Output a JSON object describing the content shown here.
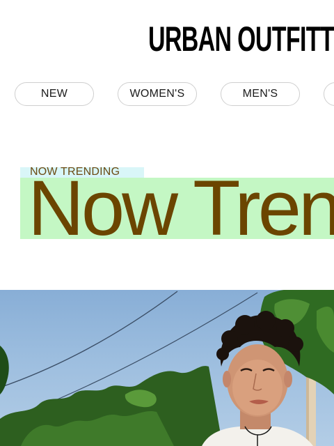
{
  "brand": {
    "logo_text": "URBAN OUTFITTERS"
  },
  "nav": {
    "categories": [
      {
        "label": "NEW"
      },
      {
        "label": "WOMEN'S"
      },
      {
        "label": "MEN'S"
      },
      {
        "label": ""
      }
    ]
  },
  "trending": {
    "eyebrow": "NOW TRENDING",
    "headline": "Now Trending",
    "eyebrow_highlight": "#d9f6f8",
    "headline_highlight": "#c4f7c4",
    "text_color": "#6b4500"
  },
  "hero": {
    "image_icon": "photo-man-outdoors"
  }
}
